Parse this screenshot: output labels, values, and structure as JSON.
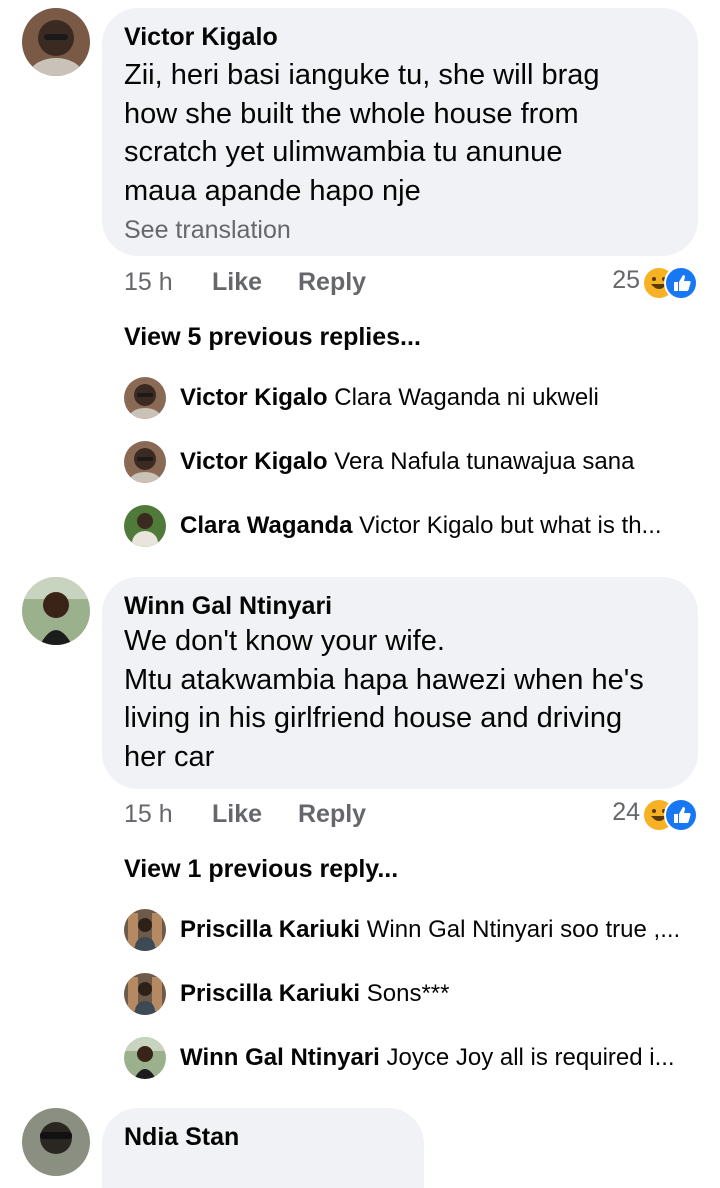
{
  "comments": [
    {
      "author": "Victor Kigalo",
      "lines": [
        "Zii, heri basi ianguke tu, she will brag",
        "how she built the whole house from",
        "scratch yet ulimwambia tu anunue",
        "maua apande hapo nje"
      ],
      "see_translation": "See translation",
      "time": "15 h",
      "like_label": "Like",
      "reply_label": "Reply",
      "reaction_count": "25",
      "reaction_icons": [
        "haha-icon",
        "like-icon"
      ],
      "view_more": "View 5 previous replies...",
      "replies": [
        {
          "author": "Victor Kigalo",
          "text": "Clara Waganda ni ukweli"
        },
        {
          "author": "Victor Kigalo",
          "text": "Vera Nafula tunawajua sana"
        },
        {
          "author": "Clara Waganda",
          "text": "Victor Kigalo but what is th..."
        }
      ]
    },
    {
      "author": "Winn Gal Ntinyari",
      "lines": [
        "We don't know your wife.",
        "Mtu atakwambia hapa hawezi when he's",
        "living in his girlfriend house and driving",
        "her car"
      ],
      "time": "15 h",
      "like_label": "Like",
      "reply_label": "Reply",
      "reaction_count": "24",
      "reaction_icons": [
        "haha-icon",
        "like-icon"
      ],
      "view_more": "View 1 previous reply...",
      "replies": [
        {
          "author": "Priscilla Kariuki",
          "text": "Winn Gal Ntinyari soo true ,..."
        },
        {
          "author": "Priscilla Kariuki",
          "text": "Sons***"
        },
        {
          "author": "Winn Gal Ntinyari",
          "text": "Joyce Joy all is required i..."
        }
      ]
    },
    {
      "author": "Ndia Stan"
    }
  ],
  "colors": {
    "bubble": "#f0f2f5",
    "secondary_text": "#65676b",
    "like_blue": "#1877f2",
    "haha_yellow": "#f7b125"
  }
}
